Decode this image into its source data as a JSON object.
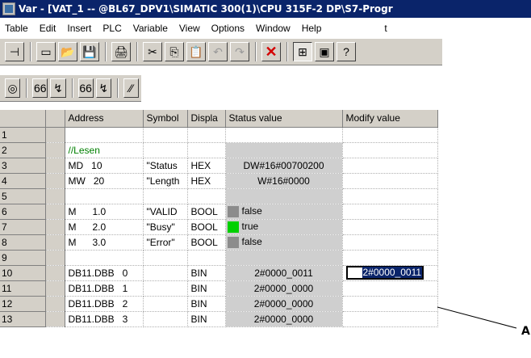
{
  "window": {
    "title": "Var - [VAT_1 -- @BL67_DPV1\\SIMATIC 300(1)\\CPU 315F-2 DP\\S7-Progr"
  },
  "menu": [
    "Table",
    "Edit",
    "Insert",
    "PLC",
    "Variable",
    "View",
    "Options",
    "Window",
    "Help"
  ],
  "menu_extra": "t",
  "toolbar1": [
    {
      "name": "pin-icon",
      "glyph": "⊣"
    },
    {
      "name": "new-icon",
      "glyph": "▭"
    },
    {
      "name": "open-icon",
      "glyph": "📂"
    },
    {
      "name": "save-icon",
      "glyph": "💾"
    },
    {
      "name": "print-icon",
      "glyph": "🖨"
    },
    {
      "name": "cut-icon",
      "glyph": "✂"
    },
    {
      "name": "copy-icon",
      "glyph": "⎘"
    },
    {
      "name": "paste-icon",
      "glyph": "📋"
    },
    {
      "name": "undo-icon",
      "glyph": "↶"
    },
    {
      "name": "redo-icon",
      "glyph": "↷"
    },
    {
      "name": "delete-icon",
      "glyph": "✕"
    },
    {
      "name": "online-icon",
      "glyph": "⊞"
    },
    {
      "name": "offline-icon",
      "glyph": "▣"
    },
    {
      "name": "help-icon",
      "glyph": "?"
    }
  ],
  "toolbar2": [
    {
      "name": "monitor-icon",
      "glyph": "◎"
    },
    {
      "name": "monitor-variable-icon",
      "glyph": "66"
    },
    {
      "name": "modify-variable-icon",
      "glyph": "↯"
    },
    {
      "name": "monitor-trigger-icon",
      "glyph": "66"
    },
    {
      "name": "modify-trigger-icon",
      "glyph": "↯"
    },
    {
      "name": "force-icon",
      "glyph": "⁄⁄"
    }
  ],
  "table": {
    "headers": [
      "",
      "",
      "Address",
      "Symbol",
      "Displa",
      "Status value",
      "Modify value"
    ],
    "rows": [
      {
        "num": "1",
        "address": "",
        "symbol": "",
        "display": "",
        "status": "",
        "modify": ""
      },
      {
        "num": "2",
        "address": "//Lesen",
        "symbol": "",
        "display": "",
        "status": "",
        "modify": "",
        "comment": true
      },
      {
        "num": "3",
        "address": "MD   10",
        "symbol": "\"Status",
        "display": "HEX",
        "status": "DW#16#00700200",
        "modify": ""
      },
      {
        "num": "4",
        "address": "MW   20",
        "symbol": "\"Length",
        "display": "HEX",
        "status": "W#16#0000",
        "modify": ""
      },
      {
        "num": "5",
        "address": "",
        "symbol": "",
        "display": "",
        "status": "",
        "modify": ""
      },
      {
        "num": "6",
        "address": "M      1.0",
        "symbol": "\"VALID",
        "display": "BOOL",
        "status": "false",
        "modify": "",
        "bool": "grey"
      },
      {
        "num": "7",
        "address": "M      2.0",
        "symbol": "\"Busy\"",
        "display": "BOOL",
        "status": "true",
        "modify": "",
        "bool": "green"
      },
      {
        "num": "8",
        "address": "M      3.0",
        "symbol": "\"Error\"",
        "display": "BOOL",
        "status": "false",
        "modify": "",
        "bool": "grey"
      },
      {
        "num": "9",
        "address": "",
        "symbol": "",
        "display": "",
        "status": "",
        "modify": ""
      },
      {
        "num": "10",
        "address": "DB11.DBB   0",
        "symbol": "",
        "display": "BIN",
        "status": "2#0000_0011",
        "modify": "2#0000_0011",
        "editing": true
      },
      {
        "num": "11",
        "address": "DB11.DBB   1",
        "symbol": "",
        "display": "BIN",
        "status": "2#0000_0000",
        "modify": ""
      },
      {
        "num": "12",
        "address": "DB11.DBB   2",
        "symbol": "",
        "display": "BIN",
        "status": "2#0000_0000",
        "modify": ""
      },
      {
        "num": "13",
        "address": "DB11.DBB   3",
        "symbol": "",
        "display": "BIN",
        "status": "2#0000_0000",
        "modify": ""
      }
    ]
  },
  "callout": {
    "label": "A"
  },
  "colors": {
    "title_bg": "#0a246a",
    "comment": "#008000",
    "status_bg": "#cfcfcf",
    "true_green": "#00d000",
    "false_grey": "#8c8c8c"
  }
}
